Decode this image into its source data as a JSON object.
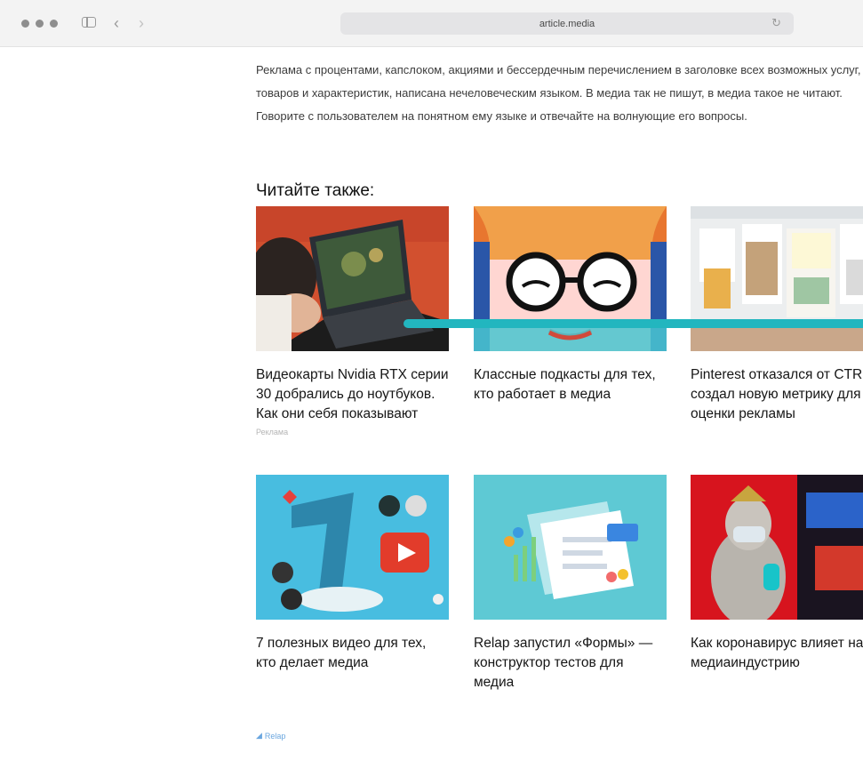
{
  "browser": {
    "url": "article.media"
  },
  "article": {
    "intro": "Реклама с процентами, капслоком, акциями и бессердечным перечислением в заголовке всех возможных услуг, товаров и характеристик, написана нечеловеческим языком. В медиа так не пишут, в медиа такое не читают. Говорите с пользователем на понятном ему языке и отвечайте на волнующие его вопросы.",
    "read_also": "Читайте также:"
  },
  "cards": [
    {
      "title": "Видеокарты Nvidia RTX серии 30 добрались до ноутбуков. Как они себя показывают",
      "label": "Реклама"
    },
    {
      "title": "Классные подкасты для тех, кто работает в медиа"
    },
    {
      "title": "Pinterest отказался от CTR и создал новую метрику для оценки рекламы"
    },
    {
      "title": "7 полезных видео для тех, кто делает медиа"
    },
    {
      "title": "Relap запустил «Формы» — конструктор тестов для медиа"
    },
    {
      "title": "Как коронавирус влияет на медиаиндустрию"
    }
  ],
  "footer": {
    "brand": "Relap"
  },
  "icons": {
    "back": "chevron-left-icon",
    "forward": "chevron-right-icon",
    "sidebar": "sidebar-icon",
    "reload": "reload-icon"
  },
  "colors": {
    "accent_slider": "#22b6bf",
    "relap_brand": "#6aa6df"
  }
}
